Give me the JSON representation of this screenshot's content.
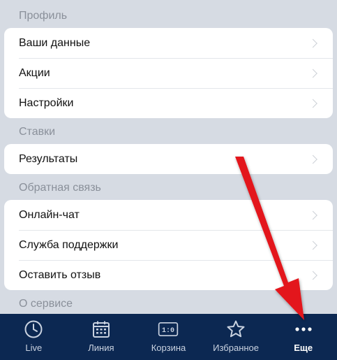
{
  "sections": [
    {
      "title": "Профиль",
      "items": [
        "Ваши данные",
        "Акции",
        "Настройки"
      ]
    },
    {
      "title": "Ставки",
      "items": [
        "Результаты"
      ]
    },
    {
      "title": "Обратная связь",
      "items": [
        "Онлайн-чат",
        "Служба поддержки",
        "Оставить отзыв"
      ]
    },
    {
      "title": "О сервисе",
      "items": []
    }
  ],
  "tabbar": {
    "tabs": [
      {
        "label": "Live",
        "icon": "clock-icon"
      },
      {
        "label": "Линия",
        "icon": "calendar-icon"
      },
      {
        "label": "Корзина",
        "icon": "scoreboard-icon",
        "icon_text": "1:0"
      },
      {
        "label": "Избранное",
        "icon": "star-icon"
      },
      {
        "label": "Еще",
        "icon": "more-dots-icon",
        "active": true
      }
    ]
  },
  "colors": {
    "tabbar_bg": "#0c2852",
    "annotation_arrow": "#e3141b",
    "background": "#d6dbe3"
  }
}
